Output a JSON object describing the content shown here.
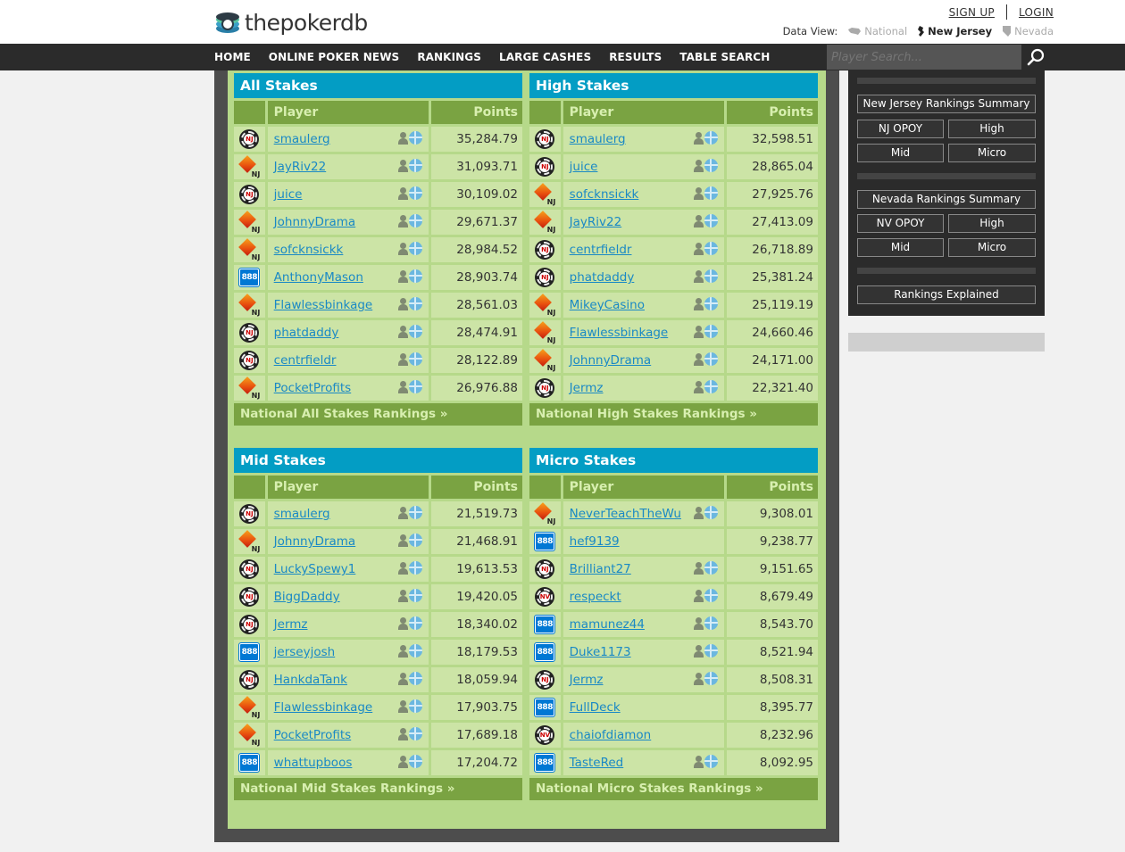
{
  "brand": {
    "name": "thepokerdb"
  },
  "auth": {
    "signup": "SIGN UP",
    "login": "LOGIN"
  },
  "dataview": {
    "label": "Data View:",
    "options": [
      {
        "label": "National",
        "state": "muted"
      },
      {
        "label": "New Jersey",
        "state": "active"
      },
      {
        "label": "Nevada",
        "state": "muted"
      }
    ]
  },
  "nav": [
    "HOME",
    "ONLINE POKER NEWS",
    "RANKINGS",
    "LARGE CASHES",
    "RESULTS",
    "TABLE SEARCH"
  ],
  "search": {
    "placeholder": "Player Search..."
  },
  "tables": [
    {
      "title": "All Stakes",
      "col_player": "Player",
      "col_points": "Points",
      "footer": "National All Stakes Rankings »",
      "rows": [
        {
          "site": "nj",
          "player": "smaulerg",
          "points": "35,284.79",
          "links": true
        },
        {
          "site": "pp",
          "player": "JayRiv22",
          "points": "31,093.71",
          "links": true
        },
        {
          "site": "nj",
          "player": "juice",
          "points": "30,109.02",
          "links": true
        },
        {
          "site": "pp",
          "player": "JohnnyDrama",
          "points": "29,671.37",
          "links": true
        },
        {
          "site": "pp",
          "player": "sofcknsickk",
          "points": "28,984.52",
          "links": true
        },
        {
          "site": "888",
          "player": "AnthonyMason",
          "points": "28,903.74",
          "links": true
        },
        {
          "site": "pp",
          "player": "Flawlessbinkage",
          "points": "28,561.03",
          "links": true
        },
        {
          "site": "nj",
          "player": "phatdaddy",
          "points": "28,474.91",
          "links": true
        },
        {
          "site": "nj",
          "player": "centrfieldr",
          "points": "28,122.89",
          "links": true
        },
        {
          "site": "pp",
          "player": "PocketProfits",
          "points": "26,976.88",
          "links": true
        }
      ]
    },
    {
      "title": "High Stakes",
      "col_player": "Player",
      "col_points": "Points",
      "footer": "National High Stakes Rankings »",
      "rows": [
        {
          "site": "nj",
          "player": "smaulerg",
          "points": "32,598.51",
          "links": true
        },
        {
          "site": "nj",
          "player": "juice",
          "points": "28,865.04",
          "links": true
        },
        {
          "site": "pp",
          "player": "sofcknsickk",
          "points": "27,925.76",
          "links": true
        },
        {
          "site": "pp",
          "player": "JayRiv22",
          "points": "27,413.09",
          "links": true
        },
        {
          "site": "nj",
          "player": "centrfieldr",
          "points": "26,718.89",
          "links": true
        },
        {
          "site": "nj",
          "player": "phatdaddy",
          "points": "25,381.24",
          "links": true
        },
        {
          "site": "pp",
          "player": "MikeyCasino",
          "points": "25,119.19",
          "links": true
        },
        {
          "site": "pp",
          "player": "Flawlessbinkage",
          "points": "24,660.46",
          "links": true
        },
        {
          "site": "pp",
          "player": "JohnnyDrama",
          "points": "24,171.00",
          "links": true
        },
        {
          "site": "nj",
          "player": "Jermz",
          "points": "22,321.40",
          "links": true
        }
      ]
    },
    {
      "title": "Mid Stakes",
      "col_player": "Player",
      "col_points": "Points",
      "footer": "National Mid Stakes Rankings »",
      "rows": [
        {
          "site": "nj",
          "player": "smaulerg",
          "points": "21,519.73",
          "links": true
        },
        {
          "site": "pp",
          "player": "JohnnyDrama",
          "points": "21,468.91",
          "links": true
        },
        {
          "site": "nj",
          "player": "LuckySpewy1",
          "points": "19,613.53",
          "links": true
        },
        {
          "site": "nj",
          "player": "BiggDaddy",
          "points": "19,420.05",
          "links": true
        },
        {
          "site": "nj",
          "player": "Jermz",
          "points": "18,340.02",
          "links": true
        },
        {
          "site": "888",
          "player": "jerseyjosh",
          "points": "18,179.53",
          "links": true
        },
        {
          "site": "nj",
          "player": "HankdaTank",
          "points": "18,059.94",
          "links": true
        },
        {
          "site": "pp",
          "player": "Flawlessbinkage",
          "points": "17,903.75",
          "links": true
        },
        {
          "site": "pp",
          "player": "PocketProfits",
          "points": "17,689.18",
          "links": true
        },
        {
          "site": "888",
          "player": "whattupboos",
          "points": "17,204.72",
          "links": true
        }
      ]
    },
    {
      "title": "Micro Stakes",
      "col_player": "Player",
      "col_points": "Points",
      "footer": "National Micro Stakes Rankings »",
      "rows": [
        {
          "site": "pp",
          "player": "NeverTeachTheWu",
          "points": "9,308.01",
          "links": true
        },
        {
          "site": "888",
          "player": "hef9139",
          "points": "9,238.77",
          "links": false
        },
        {
          "site": "nj",
          "player": "Brilliant27",
          "points": "9,151.65",
          "links": true
        },
        {
          "site": "nv",
          "player": "respeckt",
          "points": "8,679.49",
          "links": true
        },
        {
          "site": "888",
          "player": "mamunez44",
          "points": "8,543.70",
          "links": true
        },
        {
          "site": "888",
          "player": "Duke1173",
          "points": "8,521.94",
          "links": true
        },
        {
          "site": "nj",
          "player": "Jermz",
          "points": "8,508.31",
          "links": true
        },
        {
          "site": "888",
          "player": "FullDeck",
          "points": "8,395.77",
          "links": false
        },
        {
          "site": "nv",
          "player": "chaiofdiamon",
          "points": "8,232.96",
          "links": false
        },
        {
          "site": "888",
          "player": "TasteRed",
          "points": "8,092.95",
          "links": true
        }
      ]
    }
  ],
  "site_badges": {
    "nj": "NJ",
    "nv": "NV",
    "888": "888",
    "pp": "NJ"
  },
  "sidebar": {
    "nj_summary": "New Jersey Rankings Summary",
    "nj_opoy": "NJ OPOY",
    "nj_high": "High",
    "nj_mid": "Mid",
    "nj_micro": "Micro",
    "nv_summary": "Nevada Rankings Summary",
    "nv_opoy": "NV OPOY",
    "nv_high": "High",
    "nv_mid": "Mid",
    "nv_micro": "Micro",
    "explained": "Rankings Explained"
  },
  "colors": {
    "header_bar": "#2b2b2b",
    "title_bar": "#039dc4",
    "column_header": "#7aa342",
    "row_bg": "#cce4a6",
    "panel_bg": "#b6d98a",
    "link": "#1a89c5"
  }
}
